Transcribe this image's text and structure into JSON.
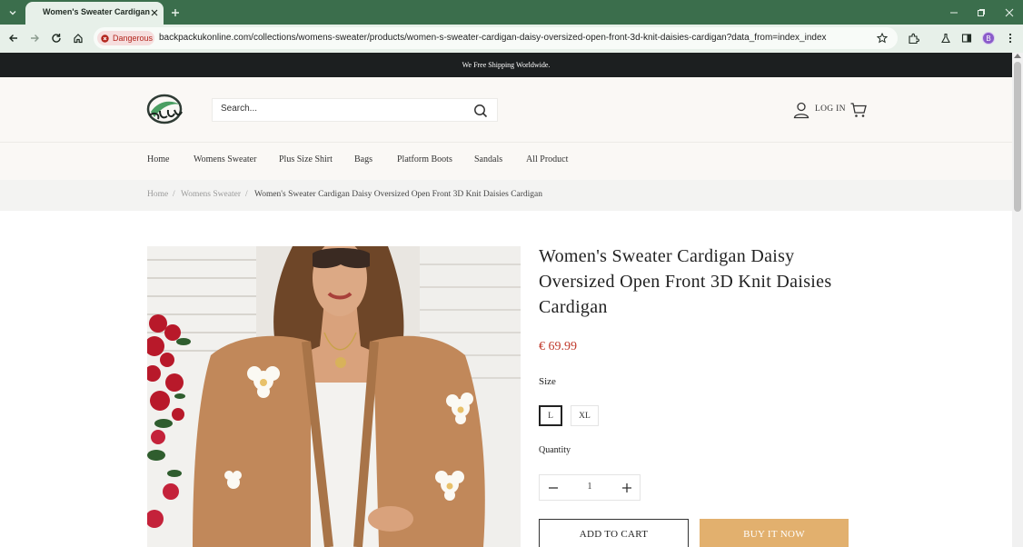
{
  "browser": {
    "tab_title": "Women's Sweater Cardigan Da",
    "security_label": "Dangerous",
    "url": "backpackukonline.com/collections/womens-sweater/products/women-s-sweater-cardigan-daisy-oversized-open-front-3d-knit-daisies-cardigan?data_from=index_index",
    "profile_initial": "B"
  },
  "announcement": "We Free Shipping Worldwide.",
  "header": {
    "search_placeholder": "Search...",
    "login_label": "LOG IN"
  },
  "nav": {
    "items": [
      "Home",
      "Womens Sweater",
      "Plus Size Shirt",
      "Bags",
      "Platform Boots",
      "Sandals",
      "All Product"
    ]
  },
  "breadcrumb": {
    "home": "Home",
    "separator": "/",
    "category": "Womens Sweater",
    "current": "Women's Sweater Cardigan Daisy Oversized Open Front 3D Knit Daisies Cardigan"
  },
  "product": {
    "title": "Women's Sweater Cardigan Daisy Oversized Open Front 3D Knit Daisies Cardigan",
    "price": "€ 69.99",
    "size_label": "Size",
    "sizes": [
      "L",
      "XL"
    ],
    "selected_size": "L",
    "quantity_label": "Quantity",
    "quantity": "1",
    "add_to_cart_label": "ADD TO CART",
    "buy_now_label": "BUY IT NOW"
  },
  "colors": {
    "browser_frame": "#3b6e4c",
    "announcement_bg": "#1c1f20",
    "price": "#c0392b",
    "buy_button": "#e2b06e",
    "danger": "#b3261e"
  }
}
